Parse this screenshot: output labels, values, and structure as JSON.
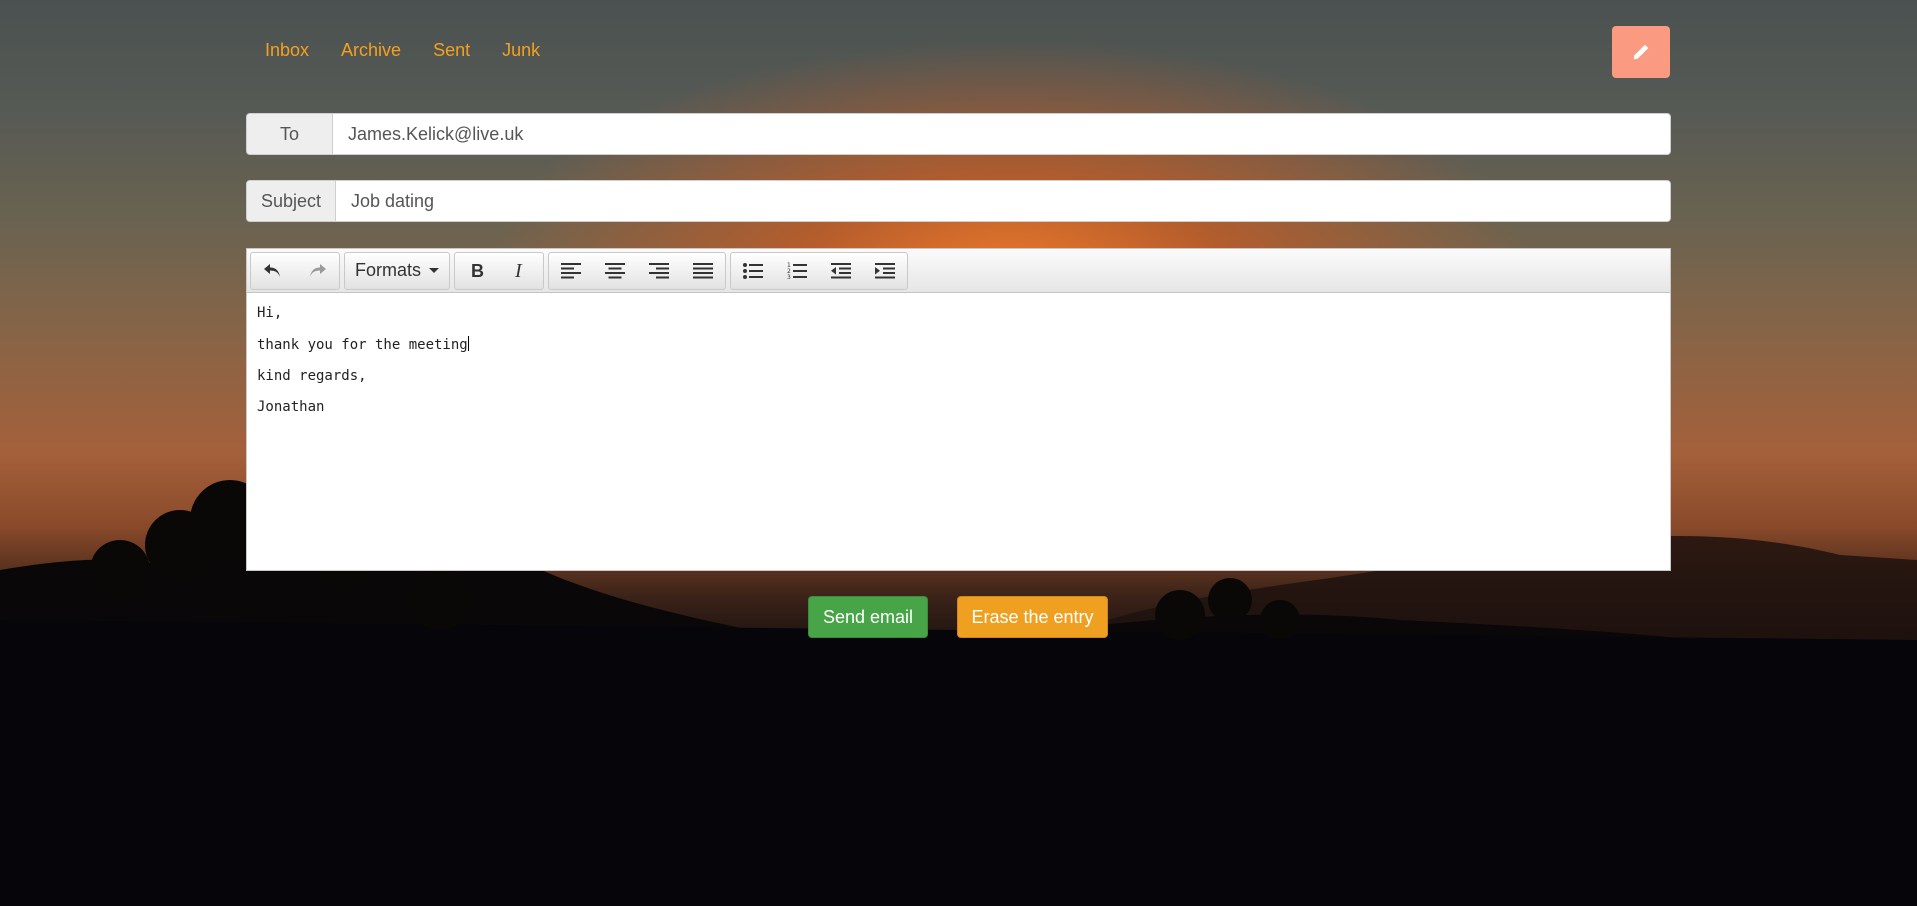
{
  "nav": {
    "items": [
      {
        "label": "Inbox"
      },
      {
        "label": "Archive"
      },
      {
        "label": "Sent"
      },
      {
        "label": "Junk"
      }
    ]
  },
  "compose": {
    "icon": "pencil-icon",
    "color": "#fa9a80"
  },
  "to": {
    "label": "To",
    "value": "James.Kelick@live.uk"
  },
  "subject": {
    "label": "Subject",
    "value": "Job dating"
  },
  "toolbar": {
    "formats_label": "Formats",
    "icons": [
      "undo-icon",
      "redo-icon",
      "bold-icon",
      "italic-icon",
      "align-left-icon",
      "align-center-icon",
      "align-right-icon",
      "align-justify-icon",
      "bullet-list-icon",
      "numbered-list-icon",
      "outdent-icon",
      "indent-icon"
    ]
  },
  "body": {
    "lines": [
      "Hi,",
      "thank you for the meeting",
      "kind regards,",
      "Jonathan"
    ]
  },
  "actions": {
    "send_label": "Send email",
    "send_color": "#47a447",
    "erase_label": "Erase the entry",
    "erase_color": "#f0a020"
  }
}
